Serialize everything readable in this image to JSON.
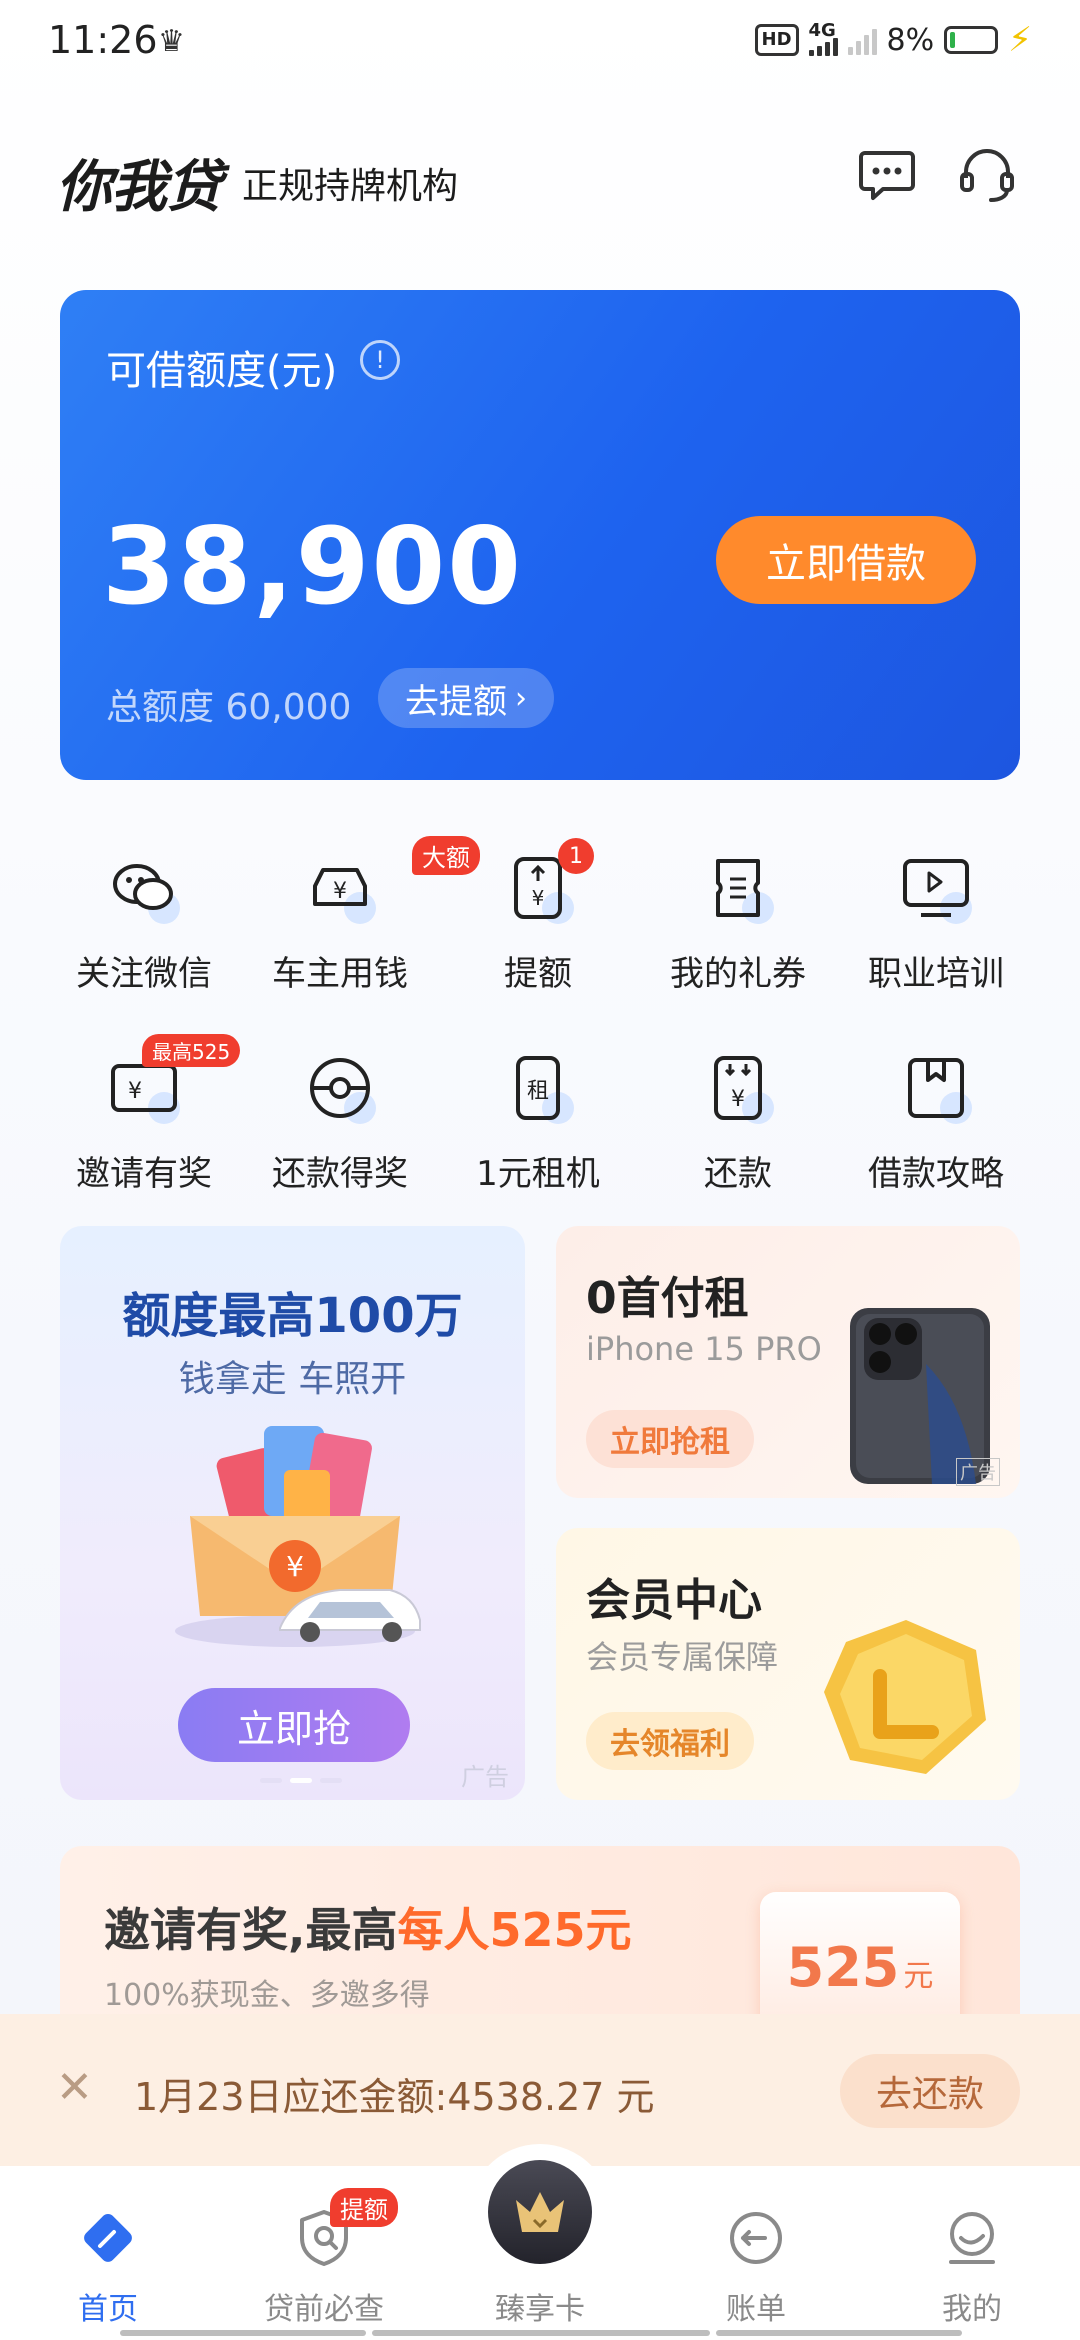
{
  "status_bar": {
    "time": "11:26",
    "hd": "HD",
    "network": "4G",
    "battery": "8%"
  },
  "header": {
    "logo": "你我贷",
    "subtitle": "正规持牌机构",
    "message_icon": "message-icon",
    "service_icon": "headset-icon"
  },
  "credit_card": {
    "label": "可借额度(元)",
    "amount": "38,900",
    "borrow_button": "立即借款",
    "total_label": "总额度 60,000",
    "raise_button": "去提额",
    "colors": {
      "card": "#1e63ef",
      "button": "#ff8a2c"
    }
  },
  "grid": {
    "row1": [
      {
        "label": "关注微信",
        "icon": "wechat-icon"
      },
      {
        "label": "车主用钱",
        "icon": "car-money-icon",
        "badge": "大额"
      },
      {
        "label": "提额",
        "icon": "raise-limit-icon",
        "badge": "1"
      },
      {
        "label": "我的礼券",
        "icon": "coupon-icon"
      },
      {
        "label": "职业培训",
        "icon": "training-icon"
      }
    ],
    "row2": [
      {
        "label": "邀请有奖",
        "icon": "invite-reward-icon",
        "badge": "最高525"
      },
      {
        "label": "还款得奖",
        "icon": "repay-reward-icon"
      },
      {
        "label": "1元租机",
        "icon": "phone-rent-icon"
      },
      {
        "label": "还款",
        "icon": "repay-icon"
      },
      {
        "label": "借款攻略",
        "icon": "loan-guide-icon"
      }
    ]
  },
  "promo_left": {
    "title": "额度最高100万",
    "subtitle": "钱拿走 车照开",
    "button": "立即抢",
    "ad": "广告"
  },
  "promo_right_top": {
    "title": "0首付租",
    "subtitle": "iPhone 15 PRO",
    "button": "立即抢租",
    "ad": "广告"
  },
  "promo_right_bottom": {
    "title": "会员中心",
    "subtitle": "会员专属保障",
    "button": "去领福利"
  },
  "invite_banner": {
    "title_prefix": "邀请有奖,最高",
    "title_highlight": "每人525元",
    "subtitle": "100%获现金、多邀多得",
    "box_amount": "525",
    "box_unit": "元"
  },
  "repay_bar": {
    "text": "1月23日应还金额:4538.27 元",
    "button": "去还款"
  },
  "tabbar": {
    "tabs": [
      {
        "label": "首页",
        "icon": "home-icon",
        "active": true
      },
      {
        "label": "贷前必查",
        "icon": "shield-check-icon",
        "badge": "提额"
      },
      {
        "label": "臻享卡",
        "icon": "crown-card-icon"
      },
      {
        "label": "账单",
        "icon": "bill-icon"
      },
      {
        "label": "我的",
        "icon": "profile-icon"
      }
    ]
  }
}
